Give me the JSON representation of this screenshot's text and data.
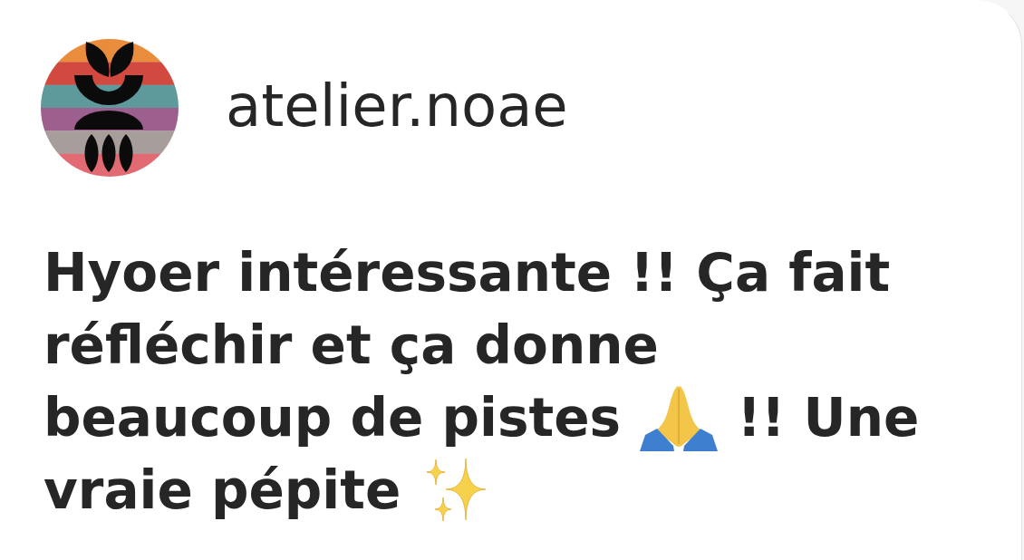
{
  "comment": {
    "author": {
      "username": "atelier.noae"
    },
    "body": [
      {
        "kind": "text",
        "text": "Hyoer intéressante !! Ça fait réfléchir et ça donne beaucoup de pistes"
      },
      {
        "kind": "prayer"
      },
      {
        "kind": "text",
        "text": "!! Une vraie pépite"
      },
      {
        "kind": "sparkles"
      }
    ]
  }
}
